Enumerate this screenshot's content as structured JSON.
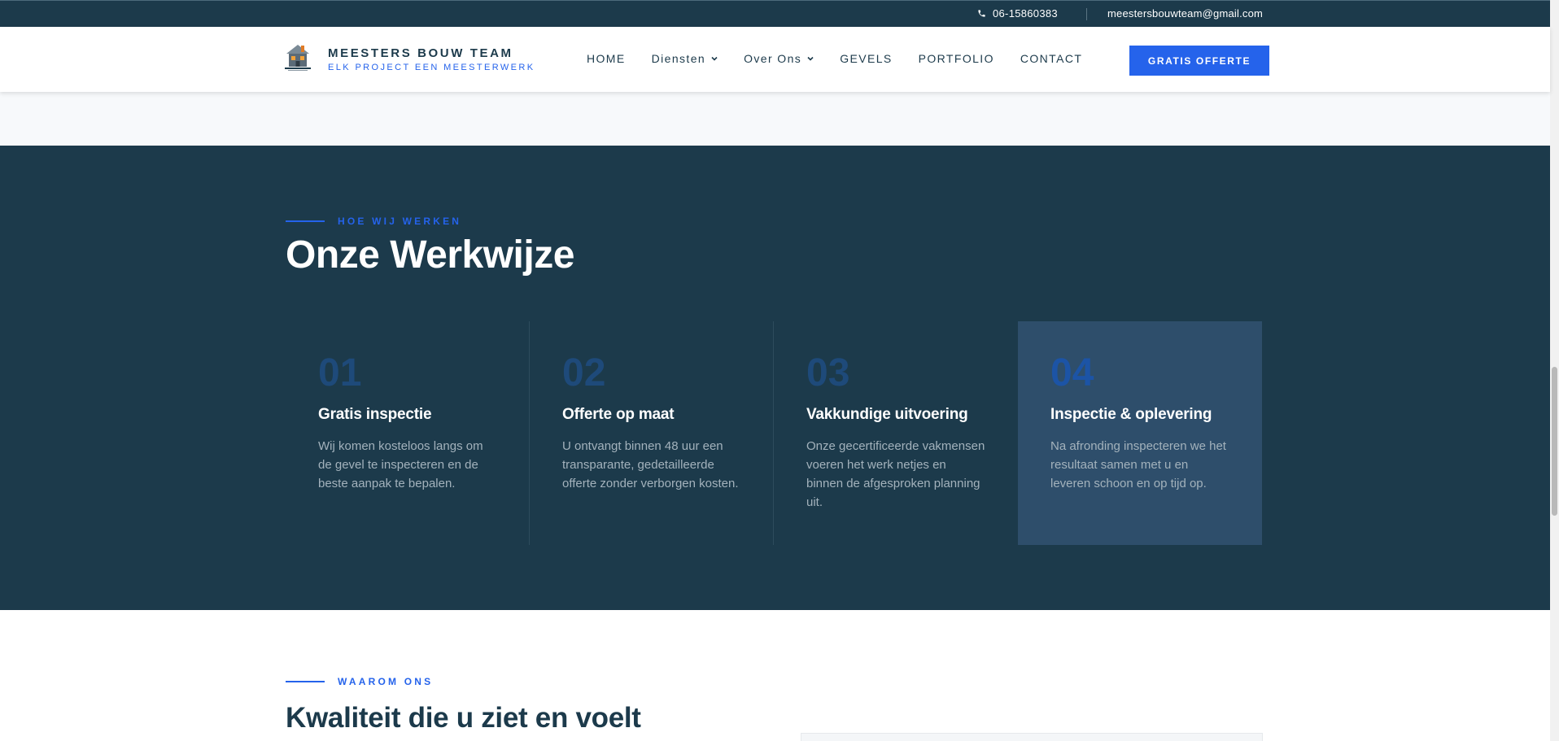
{
  "topbar": {
    "phone": "06-15860383",
    "email": "meestersbouwteam@gmail.com"
  },
  "header": {
    "brand_name": "MEESTERS BOUW TEAM",
    "brand_tagline": "ELK PROJECT EEN MEESTERWERK",
    "nav": [
      {
        "label": "HOME",
        "has_dropdown": false
      },
      {
        "label": "Diensten",
        "has_dropdown": true
      },
      {
        "label": "Over Ons",
        "has_dropdown": true
      },
      {
        "label": "GEVELS",
        "has_dropdown": false
      },
      {
        "label": "PORTFOLIO",
        "has_dropdown": false
      },
      {
        "label": "CONTACT",
        "has_dropdown": false
      }
    ],
    "cta_label": "GRATIS OFFERTE"
  },
  "process": {
    "eyebrow": "HOE WIJ WERKEN",
    "title": "Onze Werkwijze",
    "steps": [
      {
        "number": "01",
        "title": "Gratis inspectie",
        "description": "Wij komen kosteloos langs om de gevel te inspecteren en de beste aanpak te bepalen."
      },
      {
        "number": "02",
        "title": "Offerte op maat",
        "description": "U ontvangt binnen 48 uur een transparante, gedetailleerde offerte zonder verborgen kosten."
      },
      {
        "number": "03",
        "title": "Vakkundige uitvoering",
        "description": "Onze gecertificeerde vakmensen voeren het werk netjes en binnen de afgesproken planning uit."
      },
      {
        "number": "04",
        "title": "Inspectie & oplevering",
        "description": "Na afronding inspecteren we het resultaat samen met u en leveren schoon en op tijd op."
      }
    ]
  },
  "why": {
    "eyebrow": "WAAROM ONS",
    "title": "Kwaliteit die u ziet en voelt"
  },
  "colors": {
    "navy": "#1c3a4b",
    "accent": "#2563eb",
    "active_card": "#2e4e6b"
  },
  "icons": {
    "phone": "phone-icon",
    "dropdown": "chevron-down-icon"
  }
}
